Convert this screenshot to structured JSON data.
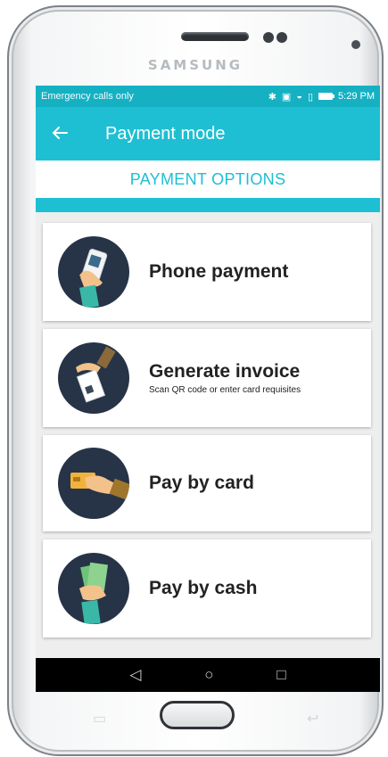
{
  "device": {
    "brand": "SAMSUNG"
  },
  "status_bar": {
    "left_text": "Emergency calls only",
    "time": "5:29 PM"
  },
  "app_bar": {
    "title": "Payment mode",
    "back_icon": "arrow-left-icon"
  },
  "tab": {
    "label": "PAYMENT OPTIONS"
  },
  "options": [
    {
      "title": "Phone payment",
      "subtitle": "",
      "icon": "phone-qr-hand-icon"
    },
    {
      "title": "Generate invoice",
      "subtitle": "Scan QR code or enter card requisites",
      "icon": "invoice-hand-icon"
    },
    {
      "title": "Pay by card",
      "subtitle": "",
      "icon": "card-hand-icon"
    },
    {
      "title": "Pay by cash",
      "subtitle": "",
      "icon": "cash-hand-icon"
    }
  ],
  "nav": {
    "back": "◁",
    "home": "○",
    "recents": "□"
  },
  "colors": {
    "accent": "#1fbfd3",
    "status": "#15b1c3",
    "avatar_bg": "#273447"
  }
}
